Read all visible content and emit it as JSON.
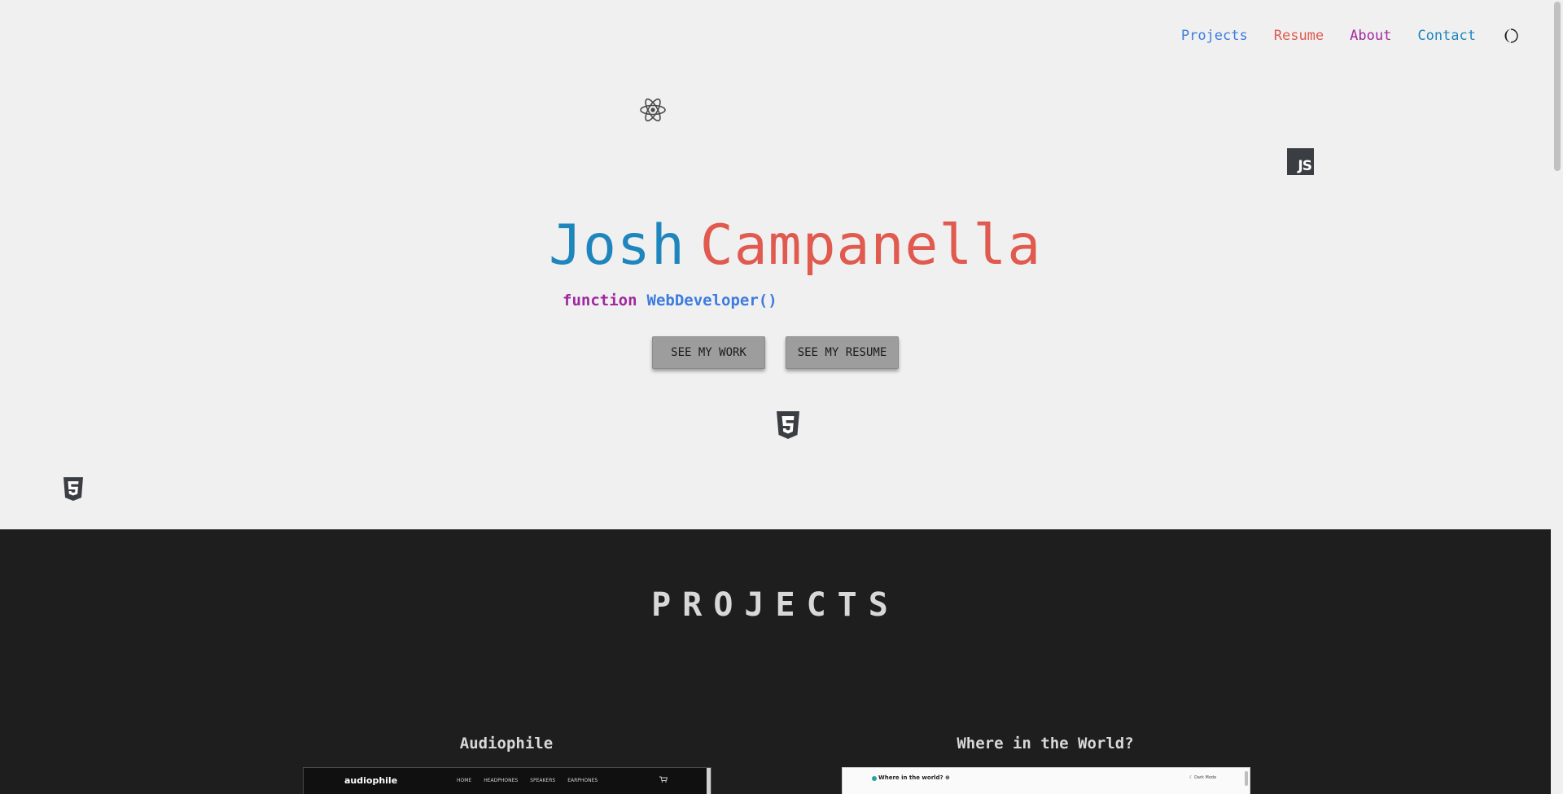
{
  "nav": {
    "items": [
      {
        "label": "Projects",
        "color": "#3d7be0"
      },
      {
        "label": "Resume",
        "color": "#e05a4f"
      },
      {
        "label": "About",
        "color": "#a0289e"
      },
      {
        "label": "Contact",
        "color": "#1f86bd"
      }
    ],
    "theme_toggle_icon": "moon-icon"
  },
  "hero": {
    "first_name": "Josh",
    "last_name": "Campanella",
    "tagline_keyword": "function",
    "tagline_function": "WebDeveloper()",
    "buttons": {
      "work_label": "SEE MY WORK",
      "resume_label": "SEE MY RESUME"
    },
    "floating_icons": [
      "react-icon",
      "javascript-icon",
      "css3-icon",
      "html5-icon"
    ],
    "js_badge": "JS"
  },
  "projects": {
    "title": "PROJECTS",
    "items": [
      {
        "name": "Audiophile",
        "preview": {
          "logo": "audiophile",
          "links": [
            "HOME",
            "HEADPHONES",
            "SPEAKERS",
            "EARPHONES"
          ]
        }
      },
      {
        "name": "Where in the World?",
        "preview": {
          "title": "Where in the world? ⊕",
          "mode": "☾ Dark Mode"
        }
      }
    ]
  },
  "colors": {
    "hero_bg": "#f0f0f0",
    "projects_bg": "#1e1e1e",
    "blue": "#1f86bd",
    "red": "#e05a4f",
    "purple": "#a0289e"
  }
}
